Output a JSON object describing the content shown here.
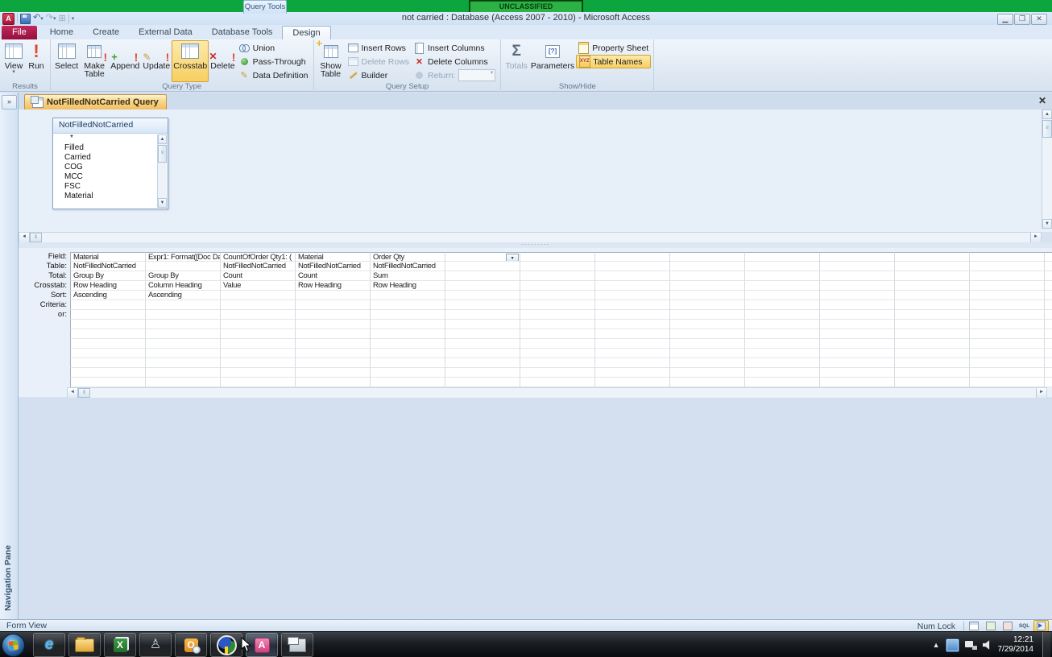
{
  "banner": {
    "label": "UNCLASSIFIED"
  },
  "title_bar": {
    "title": "not carried : Database (Access 2007 - 2010)  -  Microsoft Access",
    "contextual_group": "Query Tools"
  },
  "ribbon": {
    "tabs": {
      "file": "File",
      "home": "Home",
      "create": "Create",
      "external_data": "External Data",
      "database_tools": "Database Tools",
      "design": "Design"
    },
    "results": {
      "label": "Results",
      "view": "View",
      "run": "Run"
    },
    "query_type": {
      "label": "Query Type",
      "select": "Select",
      "make_table": "Make Table",
      "append": "Append",
      "update": "Update",
      "crosstab": "Crosstab",
      "delete": "Delete",
      "union": "Union",
      "pass_through": "Pass-Through",
      "data_definition": "Data Definition"
    },
    "query_setup": {
      "label": "Query Setup",
      "show_table": "Show Table",
      "insert_rows": "Insert Rows",
      "delete_rows": "Delete Rows",
      "builder": "Builder",
      "insert_columns": "Insert Columns",
      "delete_columns": "Delete Columns",
      "return": "Return:"
    },
    "show_hide": {
      "label": "Show/Hide",
      "totals": "Totals",
      "parameters": "Parameters",
      "property_sheet": "Property Sheet",
      "table_names": "Table Names"
    }
  },
  "nav_pane": {
    "label": "Navigation Pane",
    "expand_glyph": "»"
  },
  "document": {
    "tab_title": "NotFilledNotCarried Query",
    "field_list": {
      "title": "NotFilledNotCarried",
      "fields": [
        "*",
        "Filled",
        "Carried",
        "COG",
        "MCC",
        "FSC",
        "Material"
      ]
    },
    "grid": {
      "row_labels": [
        "Field:",
        "Table:",
        "Total:",
        "Crosstab:",
        "Sort:",
        "Criteria:",
        "or:"
      ],
      "column_count": 14,
      "empty_row_count": 7,
      "columns": [
        {
          "field": "Material",
          "table": "NotFilledNotCarried",
          "total": "Group By",
          "crosstab": "Row Heading",
          "sort": "Ascending",
          "criteria": "",
          "or": ""
        },
        {
          "field": "Expr1: Format([Doc Da",
          "table": "",
          "total": "Group By",
          "crosstab": "Column Heading",
          "sort": "Ascending",
          "criteria": "",
          "or": ""
        },
        {
          "field": "CountOfOrder Qty1: (",
          "table": "NotFilledNotCarried",
          "total": "Count",
          "crosstab": "Value",
          "sort": "",
          "criteria": "",
          "or": ""
        },
        {
          "field": "Material",
          "table": "NotFilledNotCarried",
          "total": "Count",
          "crosstab": "Row Heading",
          "sort": "",
          "criteria": "",
          "or": ""
        },
        {
          "field": "Order Qty",
          "table": "NotFilledNotCarried",
          "total": "Sum",
          "crosstab": "Row Heading",
          "sort": "",
          "criteria": "",
          "or": ""
        }
      ]
    }
  },
  "status_bar": {
    "left": "Form View",
    "num_lock": "Num Lock",
    "sql_label": "SQL"
  },
  "taskbar": {
    "clock_time": "12:21",
    "clock_date": "7/29/2014",
    "icons": [
      {
        "name": "start-button",
        "glyph": ""
      },
      {
        "name": "internet-explorer",
        "glyph": "e"
      },
      {
        "name": "windows-explorer",
        "glyph": ""
      },
      {
        "name": "excel",
        "glyph": "X"
      },
      {
        "name": "gray-app",
        "glyph": "♙"
      },
      {
        "name": "outlook",
        "glyph": "O"
      },
      {
        "name": "map-app",
        "glyph": ""
      },
      {
        "name": "access",
        "glyph": "A"
      },
      {
        "name": "window-stack-app",
        "glyph": ""
      }
    ]
  }
}
